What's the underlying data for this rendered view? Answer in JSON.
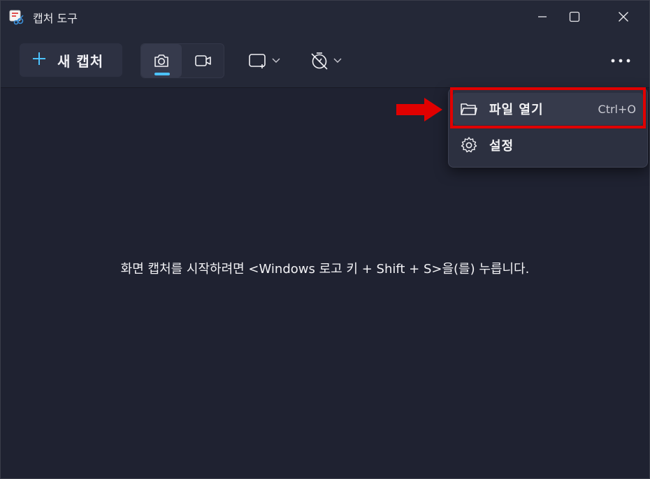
{
  "window": {
    "title": "캡처 도구",
    "app_icon": "snipping-tool-icon",
    "controls": [
      "minimize-icon",
      "maximize-icon",
      "close-icon"
    ]
  },
  "toolbar": {
    "new_capture_label": "새 캡처",
    "new_capture_icon": "plus-icon",
    "modes": [
      {
        "name": "photo",
        "icon": "camera-icon",
        "selected": true
      },
      {
        "name": "video",
        "icon": "video-camera-icon",
        "selected": false
      }
    ],
    "shape_dropdown_icon": "rectangle-snip-icon",
    "timer_dropdown_icon": "timer-off-icon",
    "more_icon": "more-horizontal-icon",
    "accent_color": "#4cc2ff"
  },
  "menu": {
    "items": [
      {
        "label": "파일 열기",
        "shortcut": "Ctrl+O",
        "icon": "folder-open-icon"
      },
      {
        "label": "설정",
        "icon": "gear-icon"
      }
    ]
  },
  "main": {
    "hint_text": "화면 캡처를 시작하려면 <Windows 로고 키 + Shift + S>을(를) 누릅니다."
  },
  "annotation": {
    "highlight_color": "#e00000",
    "arrow_icon": "red-arrow-right-icon"
  }
}
